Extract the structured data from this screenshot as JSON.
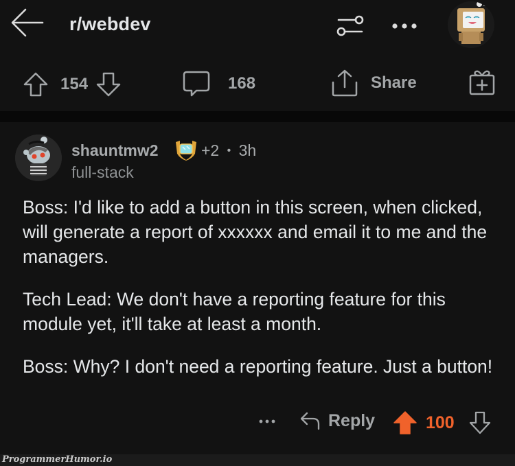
{
  "header": {
    "subreddit": "r/webdev",
    "icons": {
      "back": "arrow-left-icon",
      "filter": "sort-sliders-icon",
      "more": "more-horizontal-icon",
      "avatar": "user-avatar"
    }
  },
  "post_actions": {
    "upvotes": "154",
    "comments": "168",
    "share_label": "Share",
    "icons": {
      "upvote": "arrow-up-outline-icon",
      "downvote": "arrow-down-outline-icon",
      "comment": "speech-bubble-icon",
      "share": "share-upload-icon",
      "award": "gift-plus-icon"
    }
  },
  "comment": {
    "username": "shauntmw2",
    "award_extra": "+2",
    "separator": "•",
    "age": "3h",
    "flair": "full-stack",
    "paragraphs": [
      "Boss: I'd like to add a button in this screen, when clicked, will generate a report of xxxxxx and email it to me and the managers.",
      "Tech Lead: We don't have a reporting feature for this module yet, it'll take at least a month.",
      "Boss: Why? I don't need a reporting feature. Just a button!"
    ],
    "actions": {
      "reply_label": "Reply",
      "score": "100",
      "upvoted": true
    }
  },
  "colors": {
    "background": "#121212",
    "upvote_active": "#f0622b",
    "muted_text": "#a3a6a8",
    "body_text": "#e6e8ea"
  },
  "watermark": "ProgrammerHumor.io"
}
